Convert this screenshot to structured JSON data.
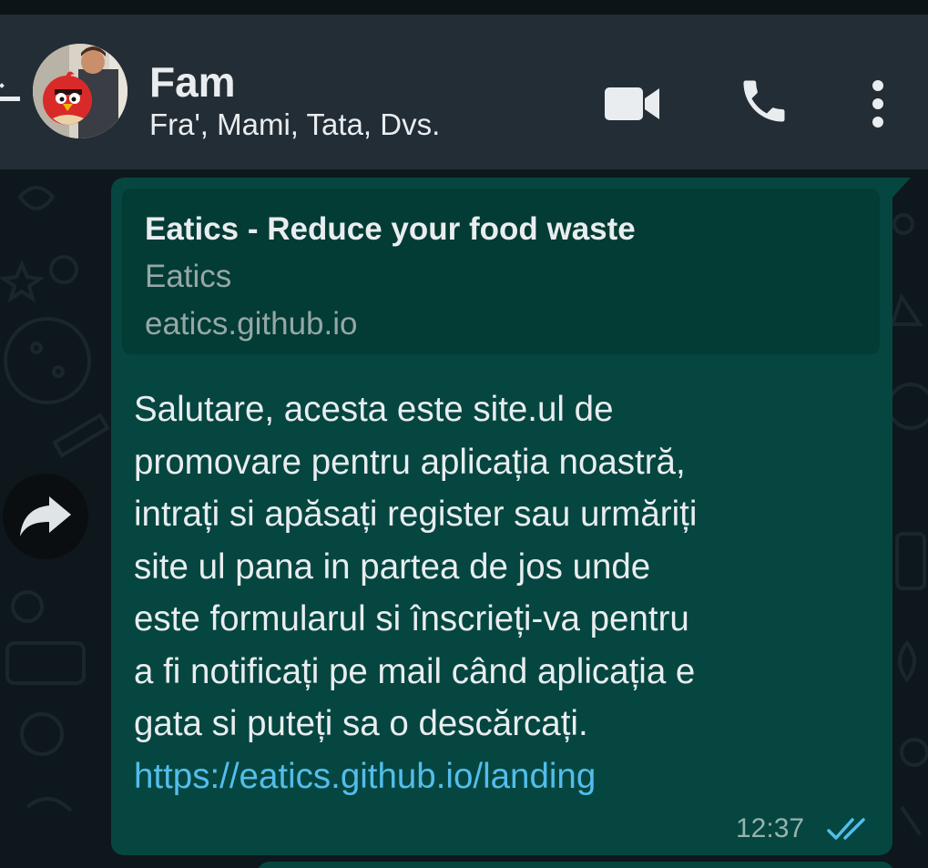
{
  "header": {
    "title": "Fam",
    "subtitle": "Fra', Mami, Tata, Dvs.",
    "icons": {
      "back": "arrow-back-icon",
      "video": "video-call-icon",
      "call": "phone-icon",
      "menu": "more-vertical-icon"
    }
  },
  "message": {
    "link_preview": {
      "title": "Eatics - Reduce your food waste",
      "site": "Eatics",
      "domain": "eatics.github.io"
    },
    "lines": [
      "Salutare, acesta este site.ul de",
      "promovare pentru aplicația noastră,",
      "intrați si apăsați register sau urmăriți",
      "site ul pana in partea de jos unde",
      "este formularul si înscrieți-va pentru",
      "a fi notificați pe mail când aplicația e",
      "gata si puteți sa o descărcați."
    ],
    "link": "https://eatics.github.io/landing",
    "time": "12:37",
    "status_icon": "double-check-read-icon"
  },
  "forward_icon": "forward-share-icon",
  "colors": {
    "header_bg": "#232d36",
    "chat_bg": "#0e171c",
    "bubble_bg": "#054640",
    "preview_bg": "#033b35",
    "text": "#e9edef",
    "muted_text": "#95a8a5",
    "link": "#53bdeb",
    "read_tick": "#53bdeb"
  }
}
